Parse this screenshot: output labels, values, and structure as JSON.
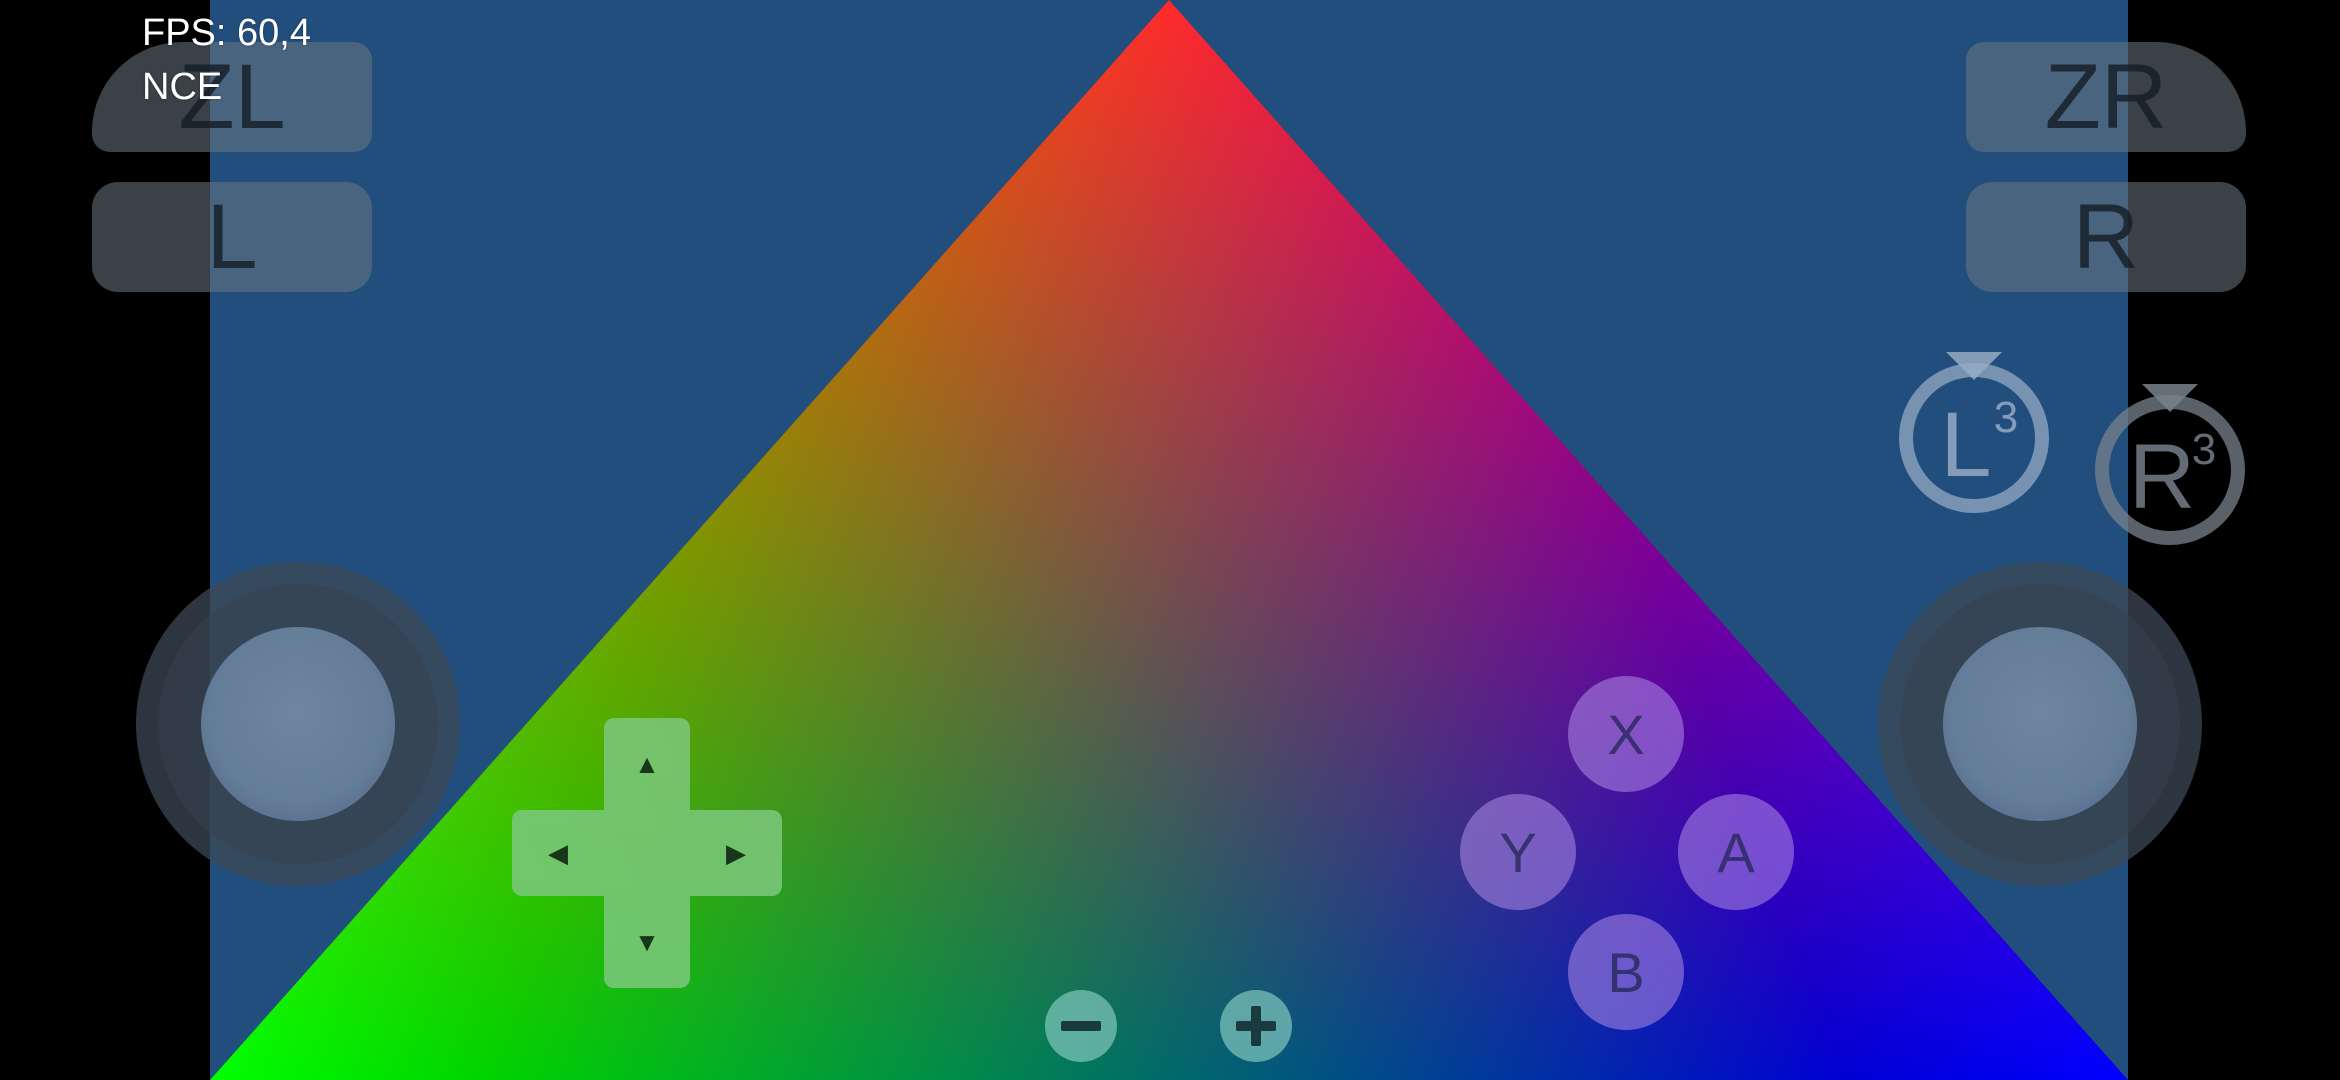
{
  "overlay": {
    "fps": "FPS: 60,4",
    "backend": "NCE"
  },
  "shoulder_buttons": {
    "zl": "ZL",
    "l": "L",
    "zr": "ZR",
    "r": "R"
  },
  "stick_buttons": {
    "l3": "L",
    "r3": "R",
    "superscript": "3"
  },
  "face_buttons": {
    "x": "X",
    "y": "Y",
    "a": "A",
    "b": "B"
  },
  "icons": {
    "dpad_up": "arrow-up-icon",
    "dpad_down": "arrow-down-icon",
    "dpad_left": "arrow-left-icon",
    "dpad_right": "arrow-right-icon",
    "minus": "minus-icon",
    "plus": "plus-icon"
  },
  "colors": {
    "game_background": "#224e7d",
    "triangle_top": "#ff0000",
    "triangle_left": "#00ff00",
    "triangle_right": "#0000ff",
    "dpad": "#7dc87d",
    "face_buttons": "#af8ce6",
    "shoulder_buttons": "#697682",
    "system_buttons": "#82c8be"
  }
}
